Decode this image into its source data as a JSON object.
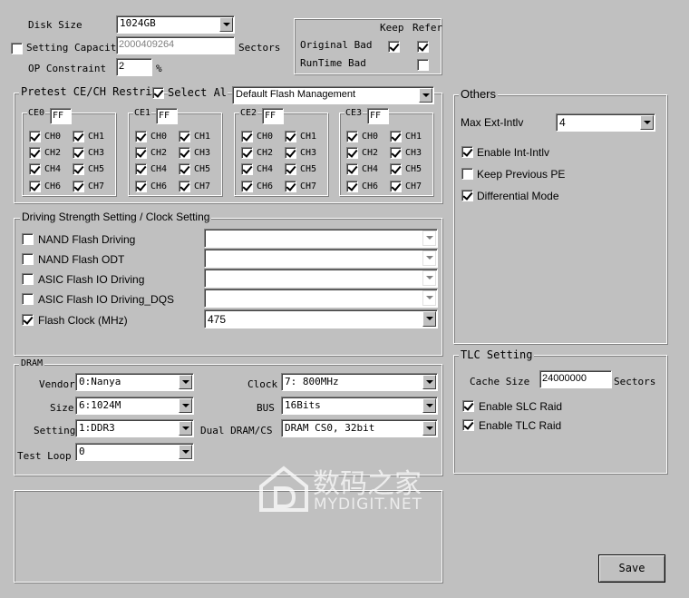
{
  "disk": {
    "disk_size_label": "Disk Size",
    "disk_size_value": "1024GB",
    "setting_capacity_label": "Setting Capacity",
    "setting_capacity_checked": false,
    "capacity_value": "2000409264",
    "sectors_label": "Sectors",
    "op_label": "OP Constraint",
    "op_value": "2",
    "op_unit": "%"
  },
  "bad_block": {
    "keep_label": "Keep",
    "refer_label": "Refer",
    "original_bad_label": "Original Bad",
    "runtime_bad_label": "RunTime Bad",
    "original_keep": true,
    "original_refer": true,
    "runtime_refer": false
  },
  "pretest": {
    "title": "Pretest CE/CH Restric",
    "select_all_label": "Select Al",
    "select_all_checked": true,
    "mgmt_value": "Default Flash Management",
    "ces": [
      {
        "label": "CE0",
        "value": "FF",
        "channels": [
          {
            "name": "CH0",
            "on": true
          },
          {
            "name": "CH1",
            "on": true
          },
          {
            "name": "CH2",
            "on": true
          },
          {
            "name": "CH3",
            "on": true
          },
          {
            "name": "CH4",
            "on": true
          },
          {
            "name": "CH5",
            "on": true
          },
          {
            "name": "CH6",
            "on": true
          },
          {
            "name": "CH7",
            "on": true
          }
        ]
      },
      {
        "label": "CE1",
        "value": "FF",
        "channels": [
          {
            "name": "CH0",
            "on": true
          },
          {
            "name": "CH1",
            "on": true
          },
          {
            "name": "CH2",
            "on": true
          },
          {
            "name": "CH3",
            "on": true
          },
          {
            "name": "CH4",
            "on": true
          },
          {
            "name": "CH5",
            "on": true
          },
          {
            "name": "CH6",
            "on": true
          },
          {
            "name": "CH7",
            "on": true
          }
        ]
      },
      {
        "label": "CE2",
        "value": "FF",
        "channels": [
          {
            "name": "CH0",
            "on": true
          },
          {
            "name": "CH1",
            "on": true
          },
          {
            "name": "CH2",
            "on": true
          },
          {
            "name": "CH3",
            "on": true
          },
          {
            "name": "CH4",
            "on": true
          },
          {
            "name": "CH5",
            "on": true
          },
          {
            "name": "CH6",
            "on": true
          },
          {
            "name": "CH7",
            "on": true
          }
        ]
      },
      {
        "label": "CE3",
        "value": "FF",
        "channels": [
          {
            "name": "CH0",
            "on": true
          },
          {
            "name": "CH1",
            "on": true
          },
          {
            "name": "CH2",
            "on": true
          },
          {
            "name": "CH3",
            "on": true
          },
          {
            "name": "CH4",
            "on": true
          },
          {
            "name": "CH5",
            "on": true
          },
          {
            "name": "CH6",
            "on": true
          },
          {
            "name": "CH7",
            "on": true
          }
        ]
      }
    ]
  },
  "driving": {
    "title": "Driving Strength Setting / Clock Setting",
    "rows": [
      {
        "label": "NAND Flash Driving",
        "checked": false,
        "value": ""
      },
      {
        "label": "NAND Flash ODT",
        "checked": false,
        "value": ""
      },
      {
        "label": "ASIC Flash IO Driving",
        "checked": false,
        "value": ""
      },
      {
        "label": "ASIC Flash IO Driving_DQS",
        "checked": false,
        "value": ""
      },
      {
        "label": "Flash Clock (MHz)",
        "checked": true,
        "value": "475"
      }
    ]
  },
  "dram": {
    "title": "DRAM",
    "vendor_label": "Vendor",
    "vendor_value": "0:Nanya",
    "size_label": "Size",
    "size_value": "6:1024M",
    "setting_label": "Setting",
    "setting_value": "1:DDR3",
    "test_loop_label": "Test  Loop",
    "test_loop_value": "0",
    "clock_label": "Clock",
    "clock_value": "7: 800MHz",
    "bus_label": "BUS",
    "bus_value": "16Bits",
    "dual_label": "Dual DRAM/CS",
    "dual_value": "DRAM CS0, 32bit"
  },
  "others": {
    "title": "Others",
    "max_ext_label": "Max Ext-Intlv",
    "max_ext_value": "4",
    "options": [
      {
        "label": "Enable Int-Intlv",
        "checked": true
      },
      {
        "label": "Keep Previous PE",
        "checked": false
      },
      {
        "label": "Differential Mode",
        "checked": true
      }
    ]
  },
  "tlc": {
    "title": "TLC Setting",
    "cache_label": "Cache  Size",
    "cache_value": "24000000",
    "sectors_label": "Sectors",
    "options": [
      {
        "label": "Enable SLC Raid",
        "checked": true
      },
      {
        "label": "Enable TLC Raid",
        "checked": true
      }
    ]
  },
  "save_label": "Save",
  "watermark": {
    "cn": "数码之家",
    "en": "MYDIGIT.NET"
  }
}
